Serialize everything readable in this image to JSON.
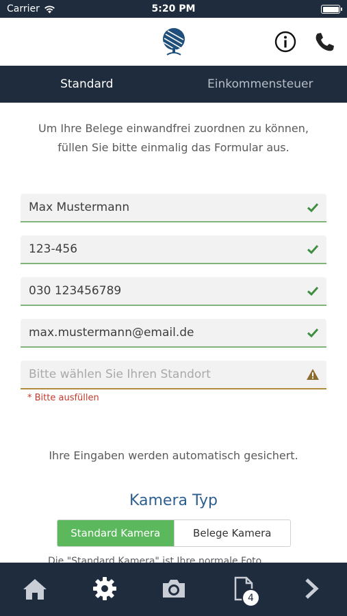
{
  "status_bar": {
    "carrier": "Carrier",
    "time": "5:20 PM"
  },
  "header": {
    "logo_icon": "tree-logo-icon",
    "info_icon": "info-icon",
    "phone_icon": "phone-icon"
  },
  "tabs": [
    {
      "label": "Standard",
      "active": true
    },
    {
      "label": "Einkommensteuer",
      "active": false
    }
  ],
  "intro_line1": "Um Ihre Belege einwandfrei zuordnen zu können,",
  "intro_line2": "füllen Sie bitte einmalig das Formular aus.",
  "form": {
    "name": {
      "value": "Max Mustermann",
      "status": "valid"
    },
    "client_number": {
      "value": "123-456",
      "status": "valid"
    },
    "phone": {
      "value": "030 123456789",
      "status": "valid"
    },
    "email": {
      "value": "max.mustermann@email.de",
      "status": "valid"
    },
    "location": {
      "value": "",
      "placeholder": "Bitte wählen Sie Ihren Standort",
      "status": "warning"
    },
    "location_error": "* Bitte ausfüllen"
  },
  "autosave_note": "Ihre Eingaben werden automatisch gesichert.",
  "camera": {
    "title": "Kamera Typ",
    "options": [
      "Standard Kamera",
      "Belege Kamera"
    ],
    "selected": "Standard Kamera",
    "truncated_text": "Die \"Standard Kamera\" ist Ihre normale Foto..."
  },
  "bottom_nav": {
    "items": [
      "home-icon",
      "settings-gear-icon",
      "camera-icon",
      "document-icon",
      "chevron-right-icon"
    ],
    "documents_badge": "4"
  },
  "colors": {
    "navy": "#1f2c3e",
    "accent_green": "#5cb85c",
    "valid_check": "#3e8e41",
    "warning": "#8a6d2f",
    "error": "#c0392b",
    "title_blue": "#2c5f8e"
  }
}
